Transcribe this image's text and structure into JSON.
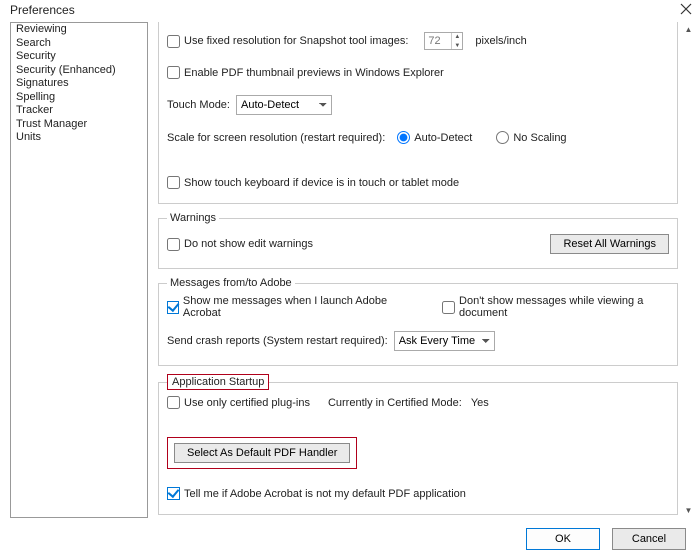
{
  "window": {
    "title": "Preferences"
  },
  "sidebar": {
    "items": [
      {
        "label": "Reviewing"
      },
      {
        "label": "Search"
      },
      {
        "label": "Security"
      },
      {
        "label": "Security (Enhanced)"
      },
      {
        "label": "Signatures"
      },
      {
        "label": "Spelling"
      },
      {
        "label": "Tracker"
      },
      {
        "label": "Trust Manager"
      },
      {
        "label": "Units"
      }
    ]
  },
  "resolution": {
    "fixed_label": "Use fixed resolution for Snapshot tool images:",
    "value": "72",
    "unit": "pixels/inch"
  },
  "thumbnail_label": "Enable PDF thumbnail previews in Windows Explorer",
  "touch": {
    "label": "Touch Mode:",
    "value": "Auto-Detect"
  },
  "scale": {
    "label": "Scale for screen resolution (restart required):",
    "opt_auto": "Auto-Detect",
    "opt_none": "No Scaling"
  },
  "touch_kbd_label": "Show touch keyboard if device is in touch or tablet mode",
  "warnings": {
    "legend": "Warnings",
    "no_edit_label": "Do not show edit warnings",
    "reset_btn": "Reset All Warnings"
  },
  "messages": {
    "legend": "Messages from/to Adobe",
    "show_launch": "Show me messages when I launch Adobe Acrobat",
    "dont_show_viewing": "Don't show messages while viewing a document",
    "crash_label": "Send crash reports (System restart required):",
    "crash_value": "Ask Every Time"
  },
  "startup": {
    "legend": "Application Startup",
    "certified_label": "Use only certified plug-ins",
    "cert_mode_label": "Currently in Certified Mode:",
    "cert_mode_value": "Yes",
    "select_handler_btn": "Select As Default PDF Handler",
    "tell_me_label": "Tell me if Adobe Acrobat is not my default PDF application"
  },
  "footer": {
    "ok": "OK",
    "cancel": "Cancel"
  }
}
